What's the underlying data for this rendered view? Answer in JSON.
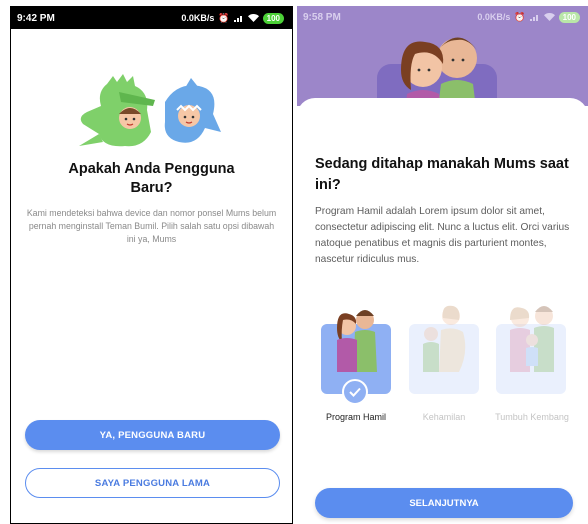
{
  "screen_welcome": {
    "status_bar": {
      "time": "9:42 PM",
      "network_speed": "0.0KB/s",
      "battery": "100"
    },
    "title": "Apakah Anda Pengguna Baru?",
    "description": "Kami mendeteksi bahwa device dan nomor ponsel Mums belum pernah menginstall Teman Bumil. Pilih salah satu opsi dibawah ini ya, Mums",
    "primary_button": "YA, PENGGUNA BARU",
    "secondary_button": "SAYA PENGGUNA LAMA"
  },
  "screen_stage": {
    "status_bar": {
      "time": "9:58 PM",
      "network_speed": "0.0KB/s",
      "battery": "100"
    },
    "title": "Sedang ditahap manakah Mums saat ini?",
    "description": "Program Hamil adalah Lorem ipsum dolor sit amet, consectetur adipiscing elit. Nunc a luctus elit. Orci varius natoque penatibus et magnis dis parturient montes, nascetur ridiculus mus.",
    "options": [
      {
        "label": "Program Hamil",
        "selected": true
      },
      {
        "label": "Kehamilan",
        "selected": false
      },
      {
        "label": "Tumbuh Kembang",
        "selected": false
      }
    ],
    "next_button": "SELANJUTNYA"
  },
  "colors": {
    "primary": "#5b8def",
    "overlay": "#9c86c9",
    "selected_card": "#8fb0f3",
    "unselected_card": "#eaf0fd"
  }
}
